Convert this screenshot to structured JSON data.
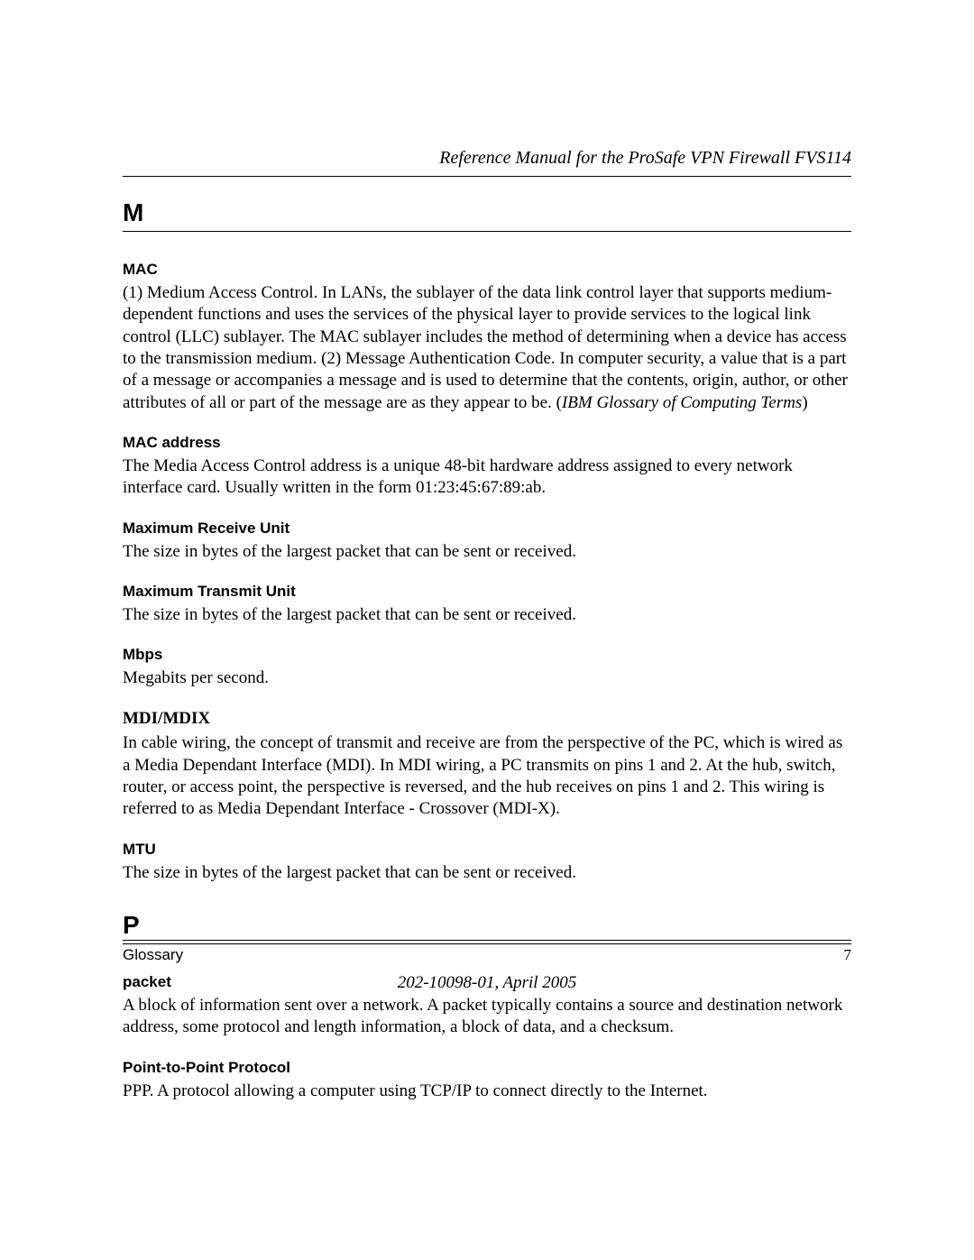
{
  "header": {
    "title": "Reference Manual for the ProSafe VPN Firewall FVS114"
  },
  "sections": {
    "m": {
      "letter": "M",
      "entries": {
        "mac": {
          "term": "MAC",
          "definition_part1": "(1) Medium Access Control. In LANs, the sublayer of the data link control layer that supports medium-dependent functions and uses the services of the physical layer to provide services to the logical link control (LLC) sublayer. The MAC sublayer includes the method of determining when a device has access to the transmission medium. (2) Message Authentication Code. In computer security, a value that is a part of a message or accompanies a message and is used to determine that the contents, origin, author, or other attributes of all or part of the message are as they appear to be. (",
          "definition_italic": "IBM Glossary of Computing Terms",
          "definition_part2": ")"
        },
        "mac_address": {
          "term": "MAC address",
          "definition": "The Media Access Control address is a unique 48-bit hardware address assigned to every network interface card. Usually written in the form 01:23:45:67:89:ab."
        },
        "max_receive_unit": {
          "term": "Maximum Receive Unit",
          "definition": "The size in bytes of the largest packet that can be sent or received."
        },
        "max_transmit_unit": {
          "term": "Maximum Transmit Unit",
          "definition": "The size in bytes of the largest packet that can be sent or received."
        },
        "mbps": {
          "term": "Mbps",
          "definition": "Megabits per second."
        },
        "mdi_mdix": {
          "term": "MDI/MDIX",
          "definition": "In cable wiring, the concept of transmit and receive are from the perspective of the PC, which is wired as a Media Dependant Interface (MDI). In MDI wiring, a PC transmits on pins 1 and 2. At the hub, switch, router, or access point, the perspective is reversed, and the hub receives on pins 1 and 2. This wiring is referred to as Media Dependant Interface - Crossover (MDI-X)."
        },
        "mtu": {
          "term": "MTU",
          "definition": "The size in bytes of the largest packet that can be sent or received."
        }
      }
    },
    "p": {
      "letter": "P",
      "entries": {
        "packet": {
          "term": "packet",
          "definition": "A block of information sent over a network. A packet typically contains a source and destination network address, some protocol and length information, a block of data, and a checksum."
        },
        "ppp": {
          "term": "Point-to-Point Protocol",
          "definition": "PPP. A protocol allowing a computer using TCP/IP to connect directly to the Internet."
        }
      }
    }
  },
  "footer": {
    "section_name": "Glossary",
    "page_number": "7",
    "doc_number": "202-10098-01, April 2005"
  }
}
